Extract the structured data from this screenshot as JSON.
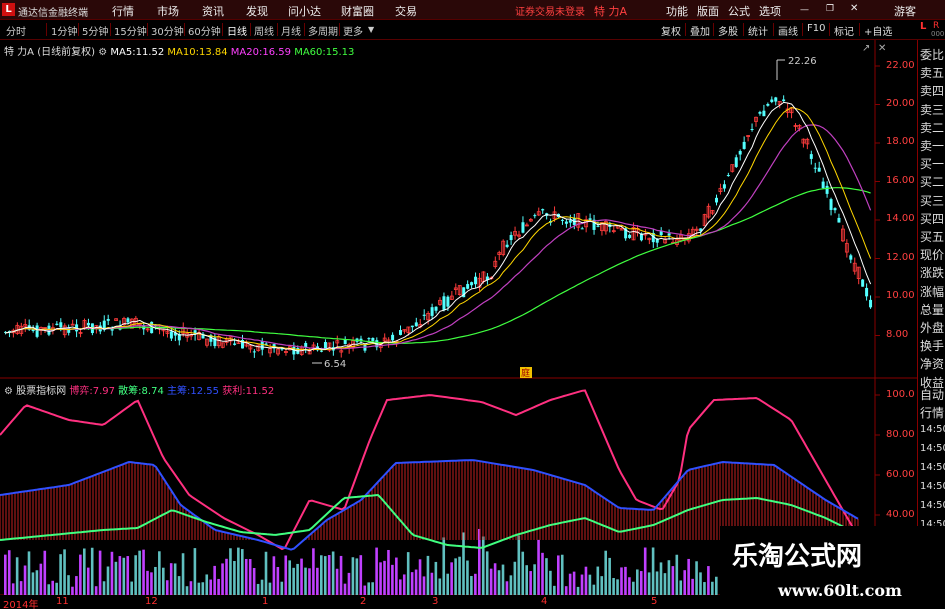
{
  "titlebar": {
    "logo": "L",
    "app_name": "通达信金融终端",
    "menus": [
      "行情",
      "市场",
      "资讯",
      "发现",
      "问小达",
      "财富圈",
      "交易"
    ],
    "notice": "证券交易未登录",
    "stock_name": "特 力A",
    "right_buttons": [
      "功能",
      "版面",
      "公式",
      "选项"
    ],
    "guest": "游客"
  },
  "period_tabs": [
    "分时",
    "1分钟",
    "5分钟",
    "15分钟",
    "30分钟",
    "60分钟",
    "日线",
    "周线",
    "月线",
    "多周期",
    "更多"
  ],
  "active_period": "日线",
  "toolbar_buttons": [
    "复权",
    "叠加",
    "多股",
    "统计",
    "画线",
    "F10",
    "标记",
    "+自选"
  ],
  "corner": {
    "L": "L",
    "R": "R",
    "num": "000"
  },
  "main_chart": {
    "stock_label": "特 力A",
    "adjust_label": "(日线前复权)",
    "ma": [
      {
        "label": "MA5:",
        "value": "11.52",
        "color": "#ffffff"
      },
      {
        "label": "MA10:",
        "value": "13.84",
        "color": "#ffd700"
      },
      {
        "label": "MA20:",
        "value": "16.59",
        "color": "#ff40ff"
      },
      {
        "label": "MA60:",
        "value": "15.13",
        "color": "#40ff40"
      }
    ],
    "price_axis": [
      "22.00",
      "20.00",
      "18.00",
      "16.00",
      "14.00",
      "12.00",
      "10.00",
      "8.00"
    ],
    "high_marker": "22.26",
    "low_marker": "6.54",
    "event_marker": "庭"
  },
  "indicator": {
    "name": "股票指标网",
    "lines": [
      {
        "label": "博弈:",
        "value": "7.97",
        "color": "#ff3080"
      },
      {
        "label": "散筹:",
        "value": "8.74",
        "color": "#40ff80"
      },
      {
        "label": "主筹:",
        "value": "12.55",
        "color": "#3050ff"
      },
      {
        "label": "获利:",
        "value": "11.52",
        "color": "#ff3080"
      }
    ],
    "axis": [
      "100.0",
      "80.00",
      "60.00",
      "40.00"
    ]
  },
  "right_panel": {
    "quote_items": [
      "委比",
      "卖五",
      "卖四",
      "卖三",
      "卖二",
      "卖一",
      "买一",
      "买二",
      "买三",
      "买四",
      "买五",
      "现价",
      "涨跌",
      "涨幅",
      "总量",
      "外盘",
      "换手",
      "净资",
      "收益"
    ],
    "tab_items": [
      "自动",
      "行情"
    ],
    "times": [
      "14:50",
      "14:50",
      "14:50",
      "14:50",
      "14:50",
      "14:50",
      "14:50"
    ]
  },
  "date_axis": [
    "2014年",
    "11",
    "12",
    "1",
    "2",
    "3",
    "4",
    "5"
  ],
  "watermark": {
    "title": "乐淘公式网",
    "url": "www.60lt.com"
  }
}
